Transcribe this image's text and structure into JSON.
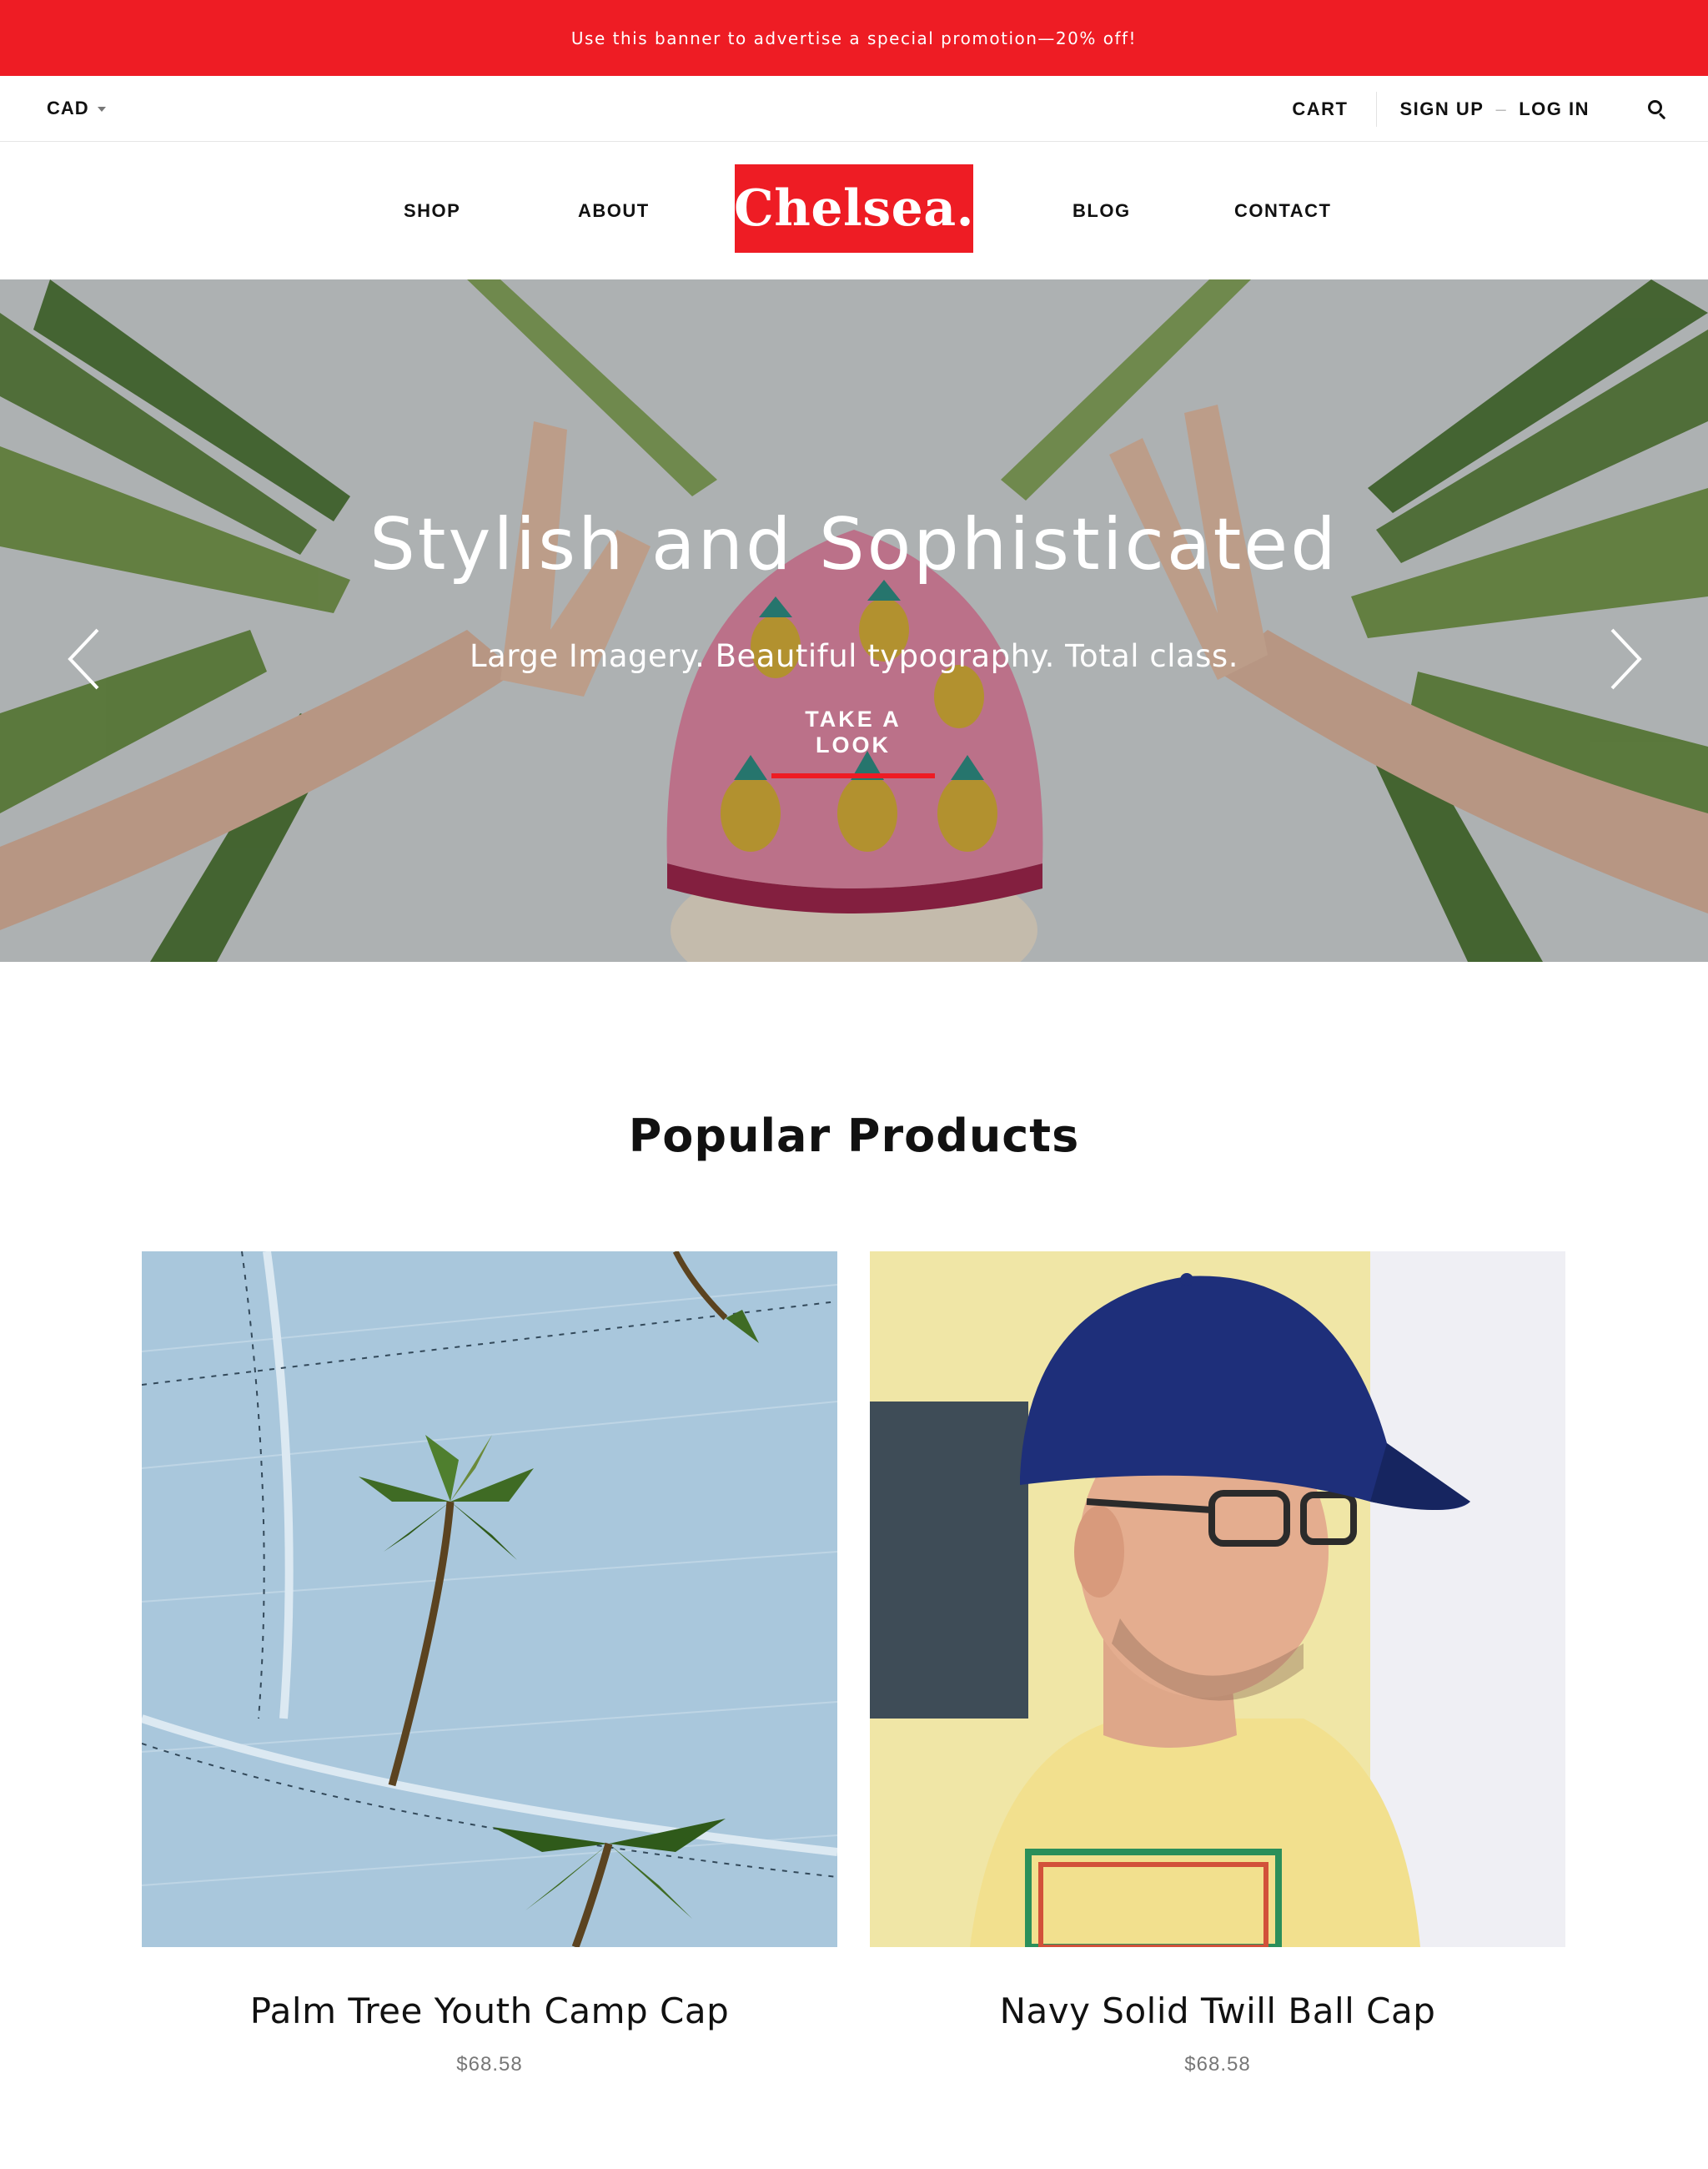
{
  "promo": {
    "text": "Use this banner to advertise a special promotion—20% off!"
  },
  "utility": {
    "currency": "CAD",
    "cart": "CART",
    "sign_up": "SIGN UP",
    "separator": "–",
    "log_in": "LOG IN"
  },
  "nav": {
    "left": [
      "SHOP",
      "ABOUT"
    ],
    "logo": "Chelsea.",
    "right": [
      "BLOG",
      "CONTACT"
    ]
  },
  "hero": {
    "title": "Stylish and Sophisticated",
    "subtitle": "Large Imagery. Beautiful typography. Total class.",
    "cta": "TAKE A LOOK"
  },
  "popular": {
    "title": "Popular Products",
    "products": [
      {
        "name": "Palm Tree Youth Camp Cap",
        "price": "$68.58"
      },
      {
        "name": "Navy Solid Twill Ball Cap",
        "price": "$68.58"
      }
    ]
  },
  "colors": {
    "brand": "#ee1c24",
    "text": "#111111",
    "muted": "#777777"
  },
  "icons": [
    "caret-down-icon",
    "search-icon",
    "chevron-left-icon",
    "chevron-right-icon"
  ]
}
